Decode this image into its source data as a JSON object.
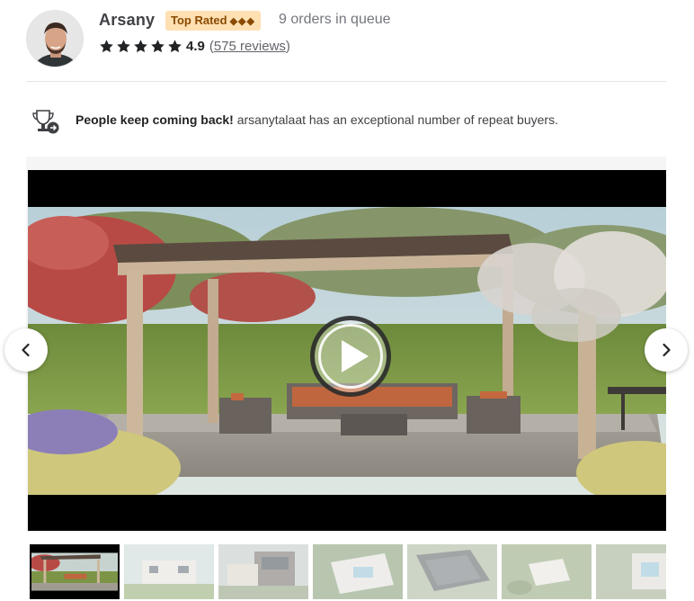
{
  "seller": {
    "name": "Arsany",
    "badge_label": "Top Rated",
    "badge_diamonds": "◆◆◆",
    "queue_text": "9 orders in queue",
    "rating": "4.9",
    "stars": 5,
    "reviews_open": "(",
    "reviews_count": "575 reviews",
    "reviews_close": ")"
  },
  "banner": {
    "bold_text": "People keep coming back!",
    "rest_text": " arsanytalaat has an exceptional number of repeat buyers."
  },
  "player": {
    "play_icon": "play-icon",
    "prev_icon": "chevron-left-icon",
    "next_icon": "chevron-right-icon"
  },
  "thumbnails": [
    {
      "name": "thumbnail-1",
      "active": true
    },
    {
      "name": "thumbnail-2",
      "active": false
    },
    {
      "name": "thumbnail-3",
      "active": false
    },
    {
      "name": "thumbnail-4",
      "active": false
    },
    {
      "name": "thumbnail-5",
      "active": false
    },
    {
      "name": "thumbnail-6",
      "active": false
    },
    {
      "name": "thumbnail-7",
      "active": false
    }
  ],
  "colors": {
    "badge_bg": "#ffe0b3",
    "badge_text": "#8a4a00",
    "text_primary": "#404145",
    "text_muted": "#74767e"
  }
}
